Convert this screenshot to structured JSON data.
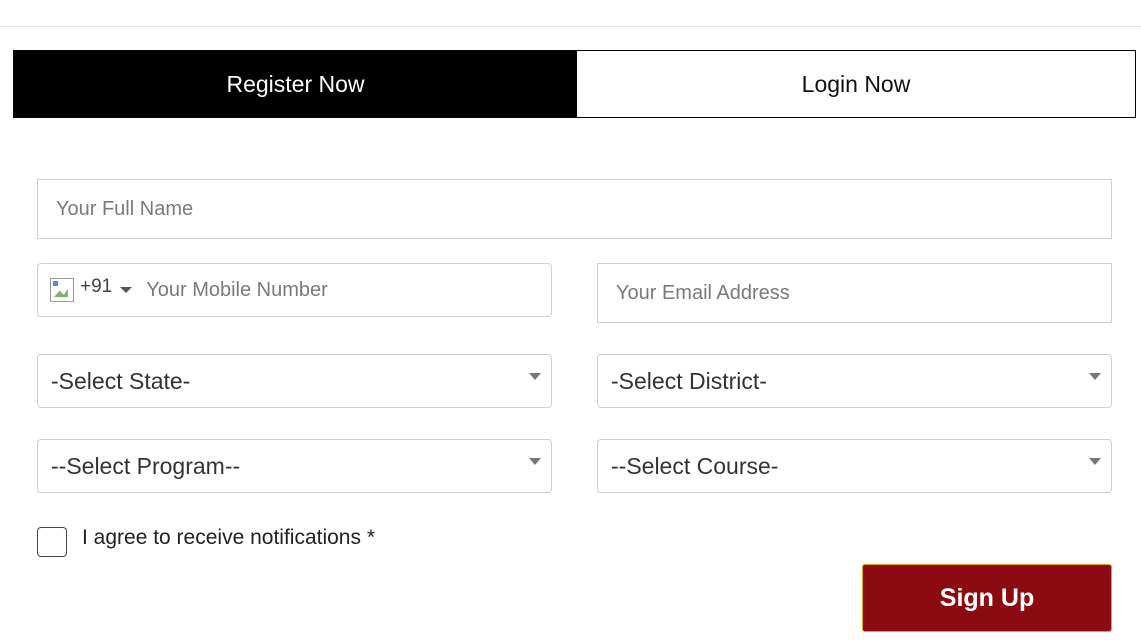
{
  "tabs": {
    "register_label": "Register Now",
    "login_label": "Login Now"
  },
  "form": {
    "full_name_placeholder": "Your Full Name",
    "phone_dial_code": "+91",
    "mobile_placeholder": "Your Mobile Number",
    "email_placeholder": "Your Email Address",
    "state_selected": "-Select State-",
    "district_selected": "-Select District-",
    "program_selected": "--Select Program--",
    "course_selected": "--Select Course-",
    "agree_label": "I agree to receive notifications *",
    "signup_label": "Sign Up"
  },
  "colors": {
    "active_tab_bg": "#000000",
    "signup_bg": "#8b0b10",
    "signup_border": "#d9a900"
  },
  "icons": {
    "flag": "broken-flag-image-icon",
    "dropdown": "caret-down-icon"
  }
}
